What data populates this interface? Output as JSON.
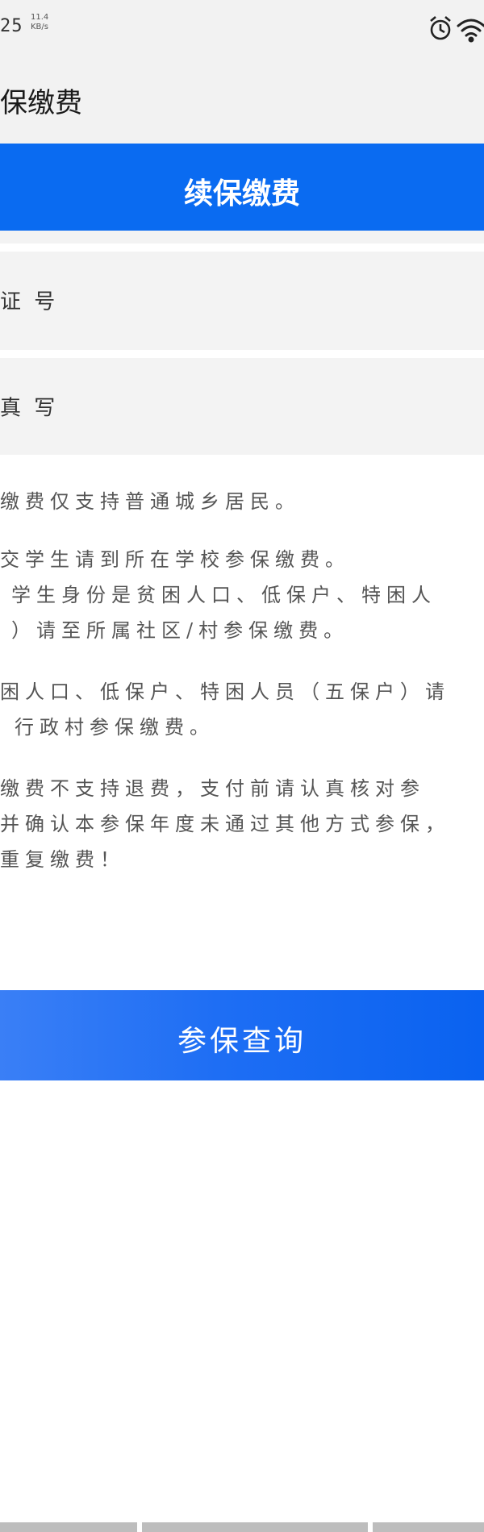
{
  "status_bar": {
    "time": "25",
    "net_speed_value": "11.4",
    "net_speed_unit": "KB/s",
    "icons": [
      "alarm-icon",
      "wifi-icon"
    ]
  },
  "header": {
    "title": "保缴费"
  },
  "banner": {
    "title": "续保缴费"
  },
  "form": {
    "id_field_label": "证 号",
    "name_field_label": "真 写"
  },
  "notice": {
    "lines": [
      "缴费仅支持普通城乡居民。",
      "交学生请到所在学校参保缴费。",
      "学生身份是贫困人口、低保户、特困人",
      "）请至所属社区/村参保缴费。",
      "困人口、低保户、特困人员（五保户）请",
      "行政村参保缴费。",
      "缴费不支持退费，支付前请认真核对参",
      "并确认本参保年度未通过其他方式参保，",
      "重复缴费！"
    ]
  },
  "actions": {
    "query_label": "参保查询"
  },
  "colors": {
    "primary": "#0a6bf1",
    "background": "#f3f3f3"
  }
}
